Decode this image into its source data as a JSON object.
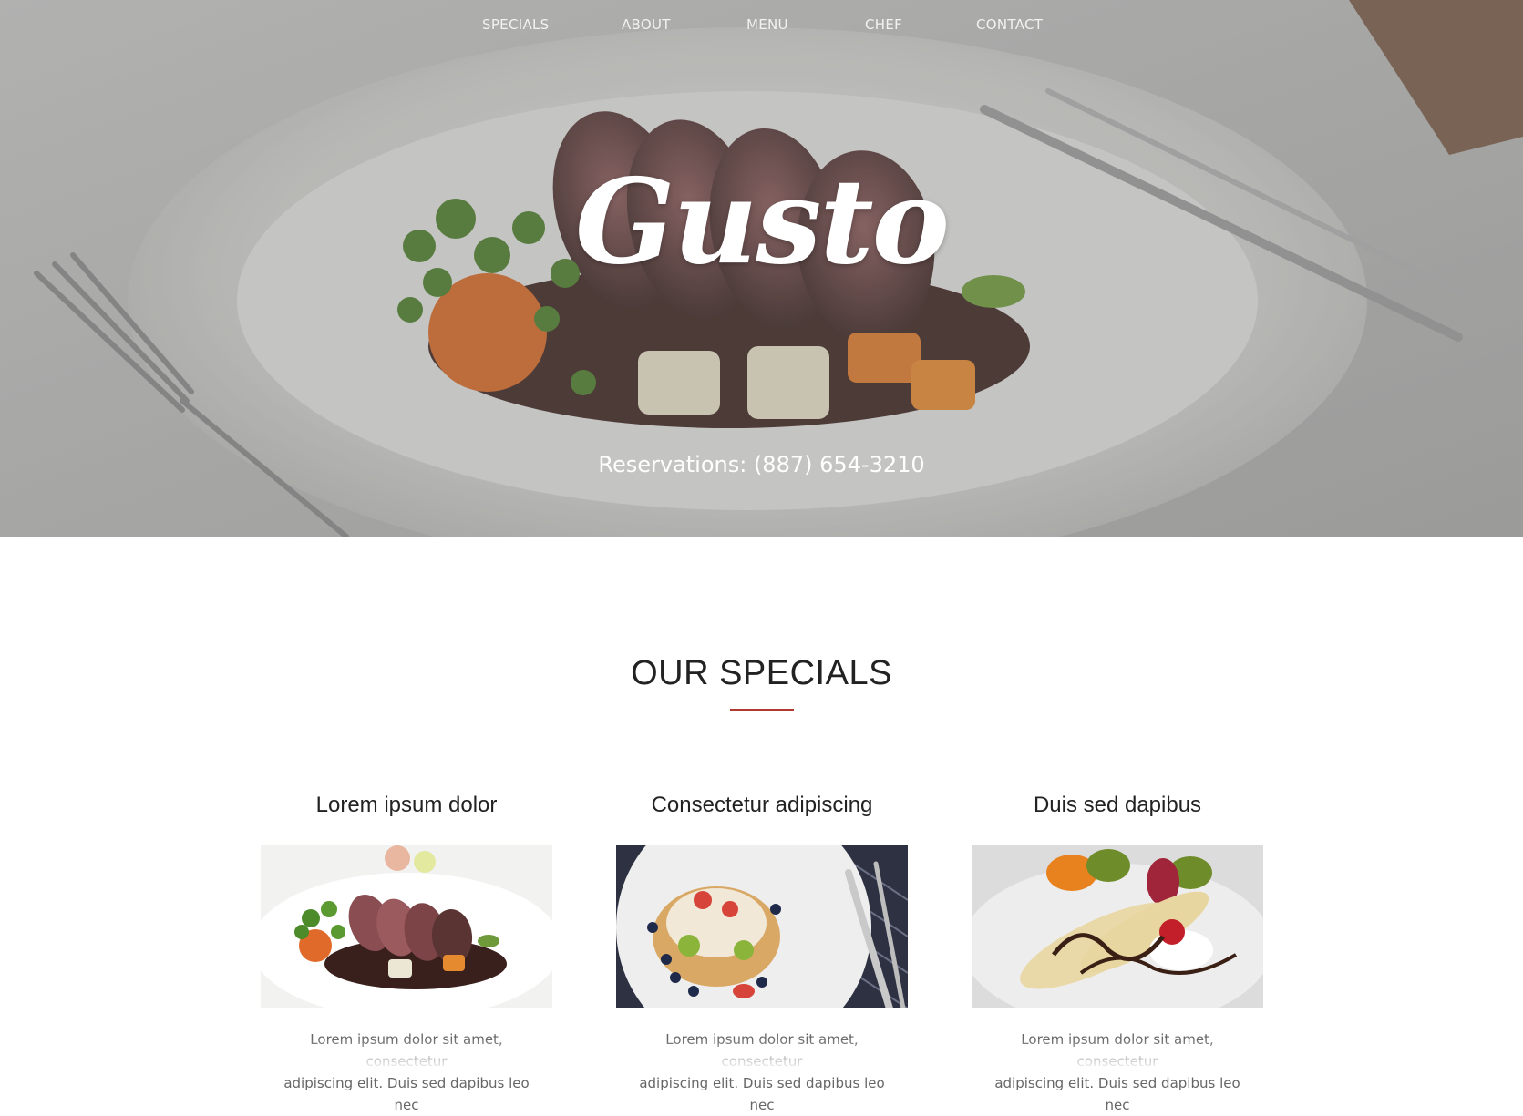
{
  "nav": {
    "items": [
      {
        "label": "SPECIALS"
      },
      {
        "label": "ABOUT"
      },
      {
        "label": "MENU"
      },
      {
        "label": "CHEF"
      },
      {
        "label": "CONTACT"
      }
    ]
  },
  "hero": {
    "brand": "Gusto",
    "reservations": "Reservations: (887) 654-3210"
  },
  "specials": {
    "title": "OUR SPECIALS",
    "accent_color": "#b03a2e",
    "cards": [
      {
        "title": "Lorem ipsum dolor",
        "image": "steak-plate-photo",
        "text_line1": "Lorem ipsum dolor sit amet, consectetur",
        "text_line2": "adipiscing elit. Duis sed dapibus leo nec"
      },
      {
        "title": "Consectetur adipiscing",
        "image": "pancakes-fruit-photo",
        "text_line1": "Lorem ipsum dolor sit amet, consectetur",
        "text_line2": "adipiscing elit. Duis sed dapibus leo nec"
      },
      {
        "title": "Duis sed dapibus",
        "image": "banana-dessert-photo",
        "text_line1": "Lorem ipsum dolor sit amet, consectetur",
        "text_line2": "adipiscing elit. Duis sed dapibus leo nec"
      }
    ]
  }
}
